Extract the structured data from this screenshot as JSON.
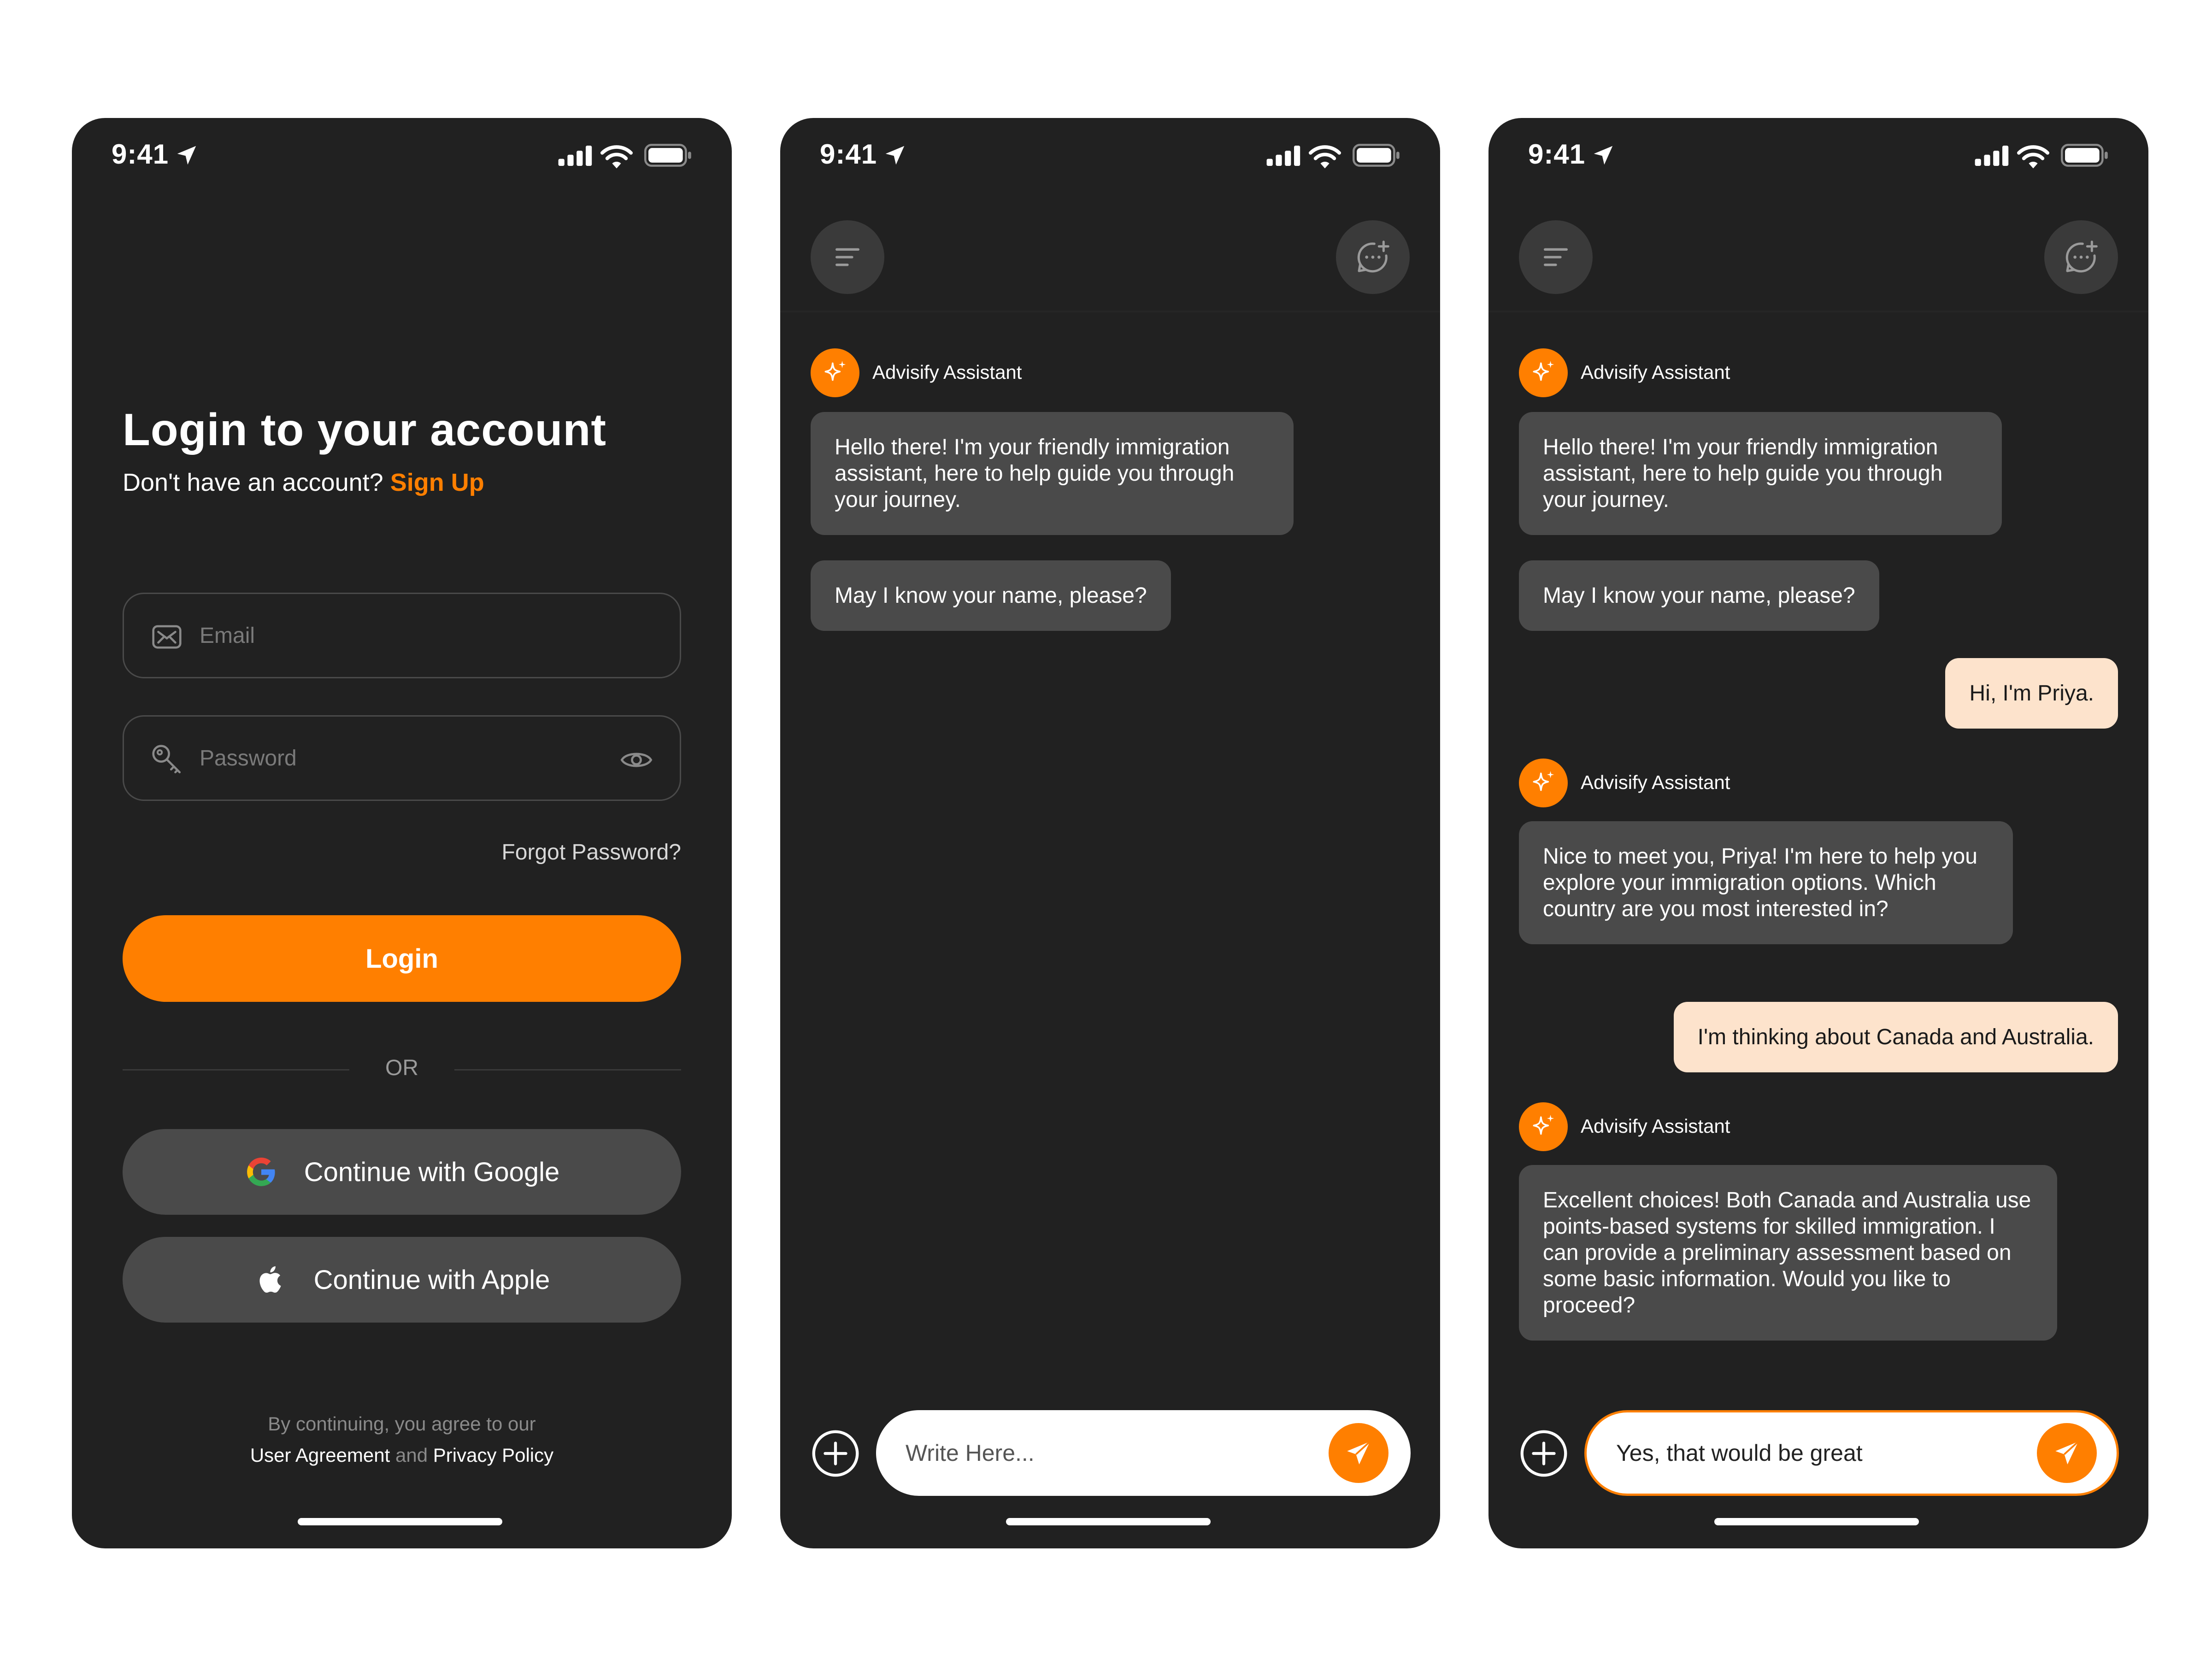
{
  "status_bar": {
    "time": "9:41"
  },
  "login": {
    "title": "Login to your account",
    "subtitle_prefix": "Don't have an account? ",
    "signup_link": "Sign Up",
    "email_placeholder": "Email",
    "password_placeholder": "Password",
    "forgot_password": "Forgot Password?",
    "login_button": "Login",
    "or_label": "OR",
    "google_button": "Continue with Google",
    "apple_button": "Continue with Apple",
    "terms_line1": "By continuing, you agree to our",
    "terms_agreement": "User Agreement",
    "terms_and": " and ",
    "terms_privacy": "Privacy Policy"
  },
  "chat_empty": {
    "assistant_name": "Advisify Assistant",
    "messages": [
      "Hello there! I'm your friendly immigration assistant, here to help guide you through your journey.",
      "May I know your name, please?"
    ],
    "composer_placeholder": "Write Here..."
  },
  "chat_full": {
    "assistant_name": "Advisify Assistant",
    "bot_msg_1": "Hello there! I'm your friendly immigration assistant, here to help guide you through your journey.",
    "bot_msg_2": "May I know your name, please?",
    "user_msg_1": "Hi, I'm Priya.",
    "bot_msg_3": "Nice to meet you, Priya! I'm here to help you explore your immigration options. Which country are you most interested in?",
    "user_msg_2": "I'm thinking about Canada and Australia.",
    "bot_msg_4": "Excellent choices! Both Canada and Australia use points-based systems for skilled immigration. I can provide a preliminary assessment based on some basic information. Would you like to proceed?",
    "composer_value": "Yes, that would be great"
  },
  "colors": {
    "accent": "#ff7f00",
    "phone_bg": "#212121",
    "bot_bubble": "#4a4a4a",
    "user_bubble": "#fde3cc"
  },
  "icons": [
    "location-arrow-icon",
    "signal-icon",
    "wifi-icon",
    "battery-icon",
    "mail-icon",
    "key-icon",
    "eye-icon",
    "google-icon",
    "apple-icon",
    "menu-icon",
    "new-chat-icon",
    "sparkle-icon",
    "plus-icon",
    "send-icon"
  ]
}
